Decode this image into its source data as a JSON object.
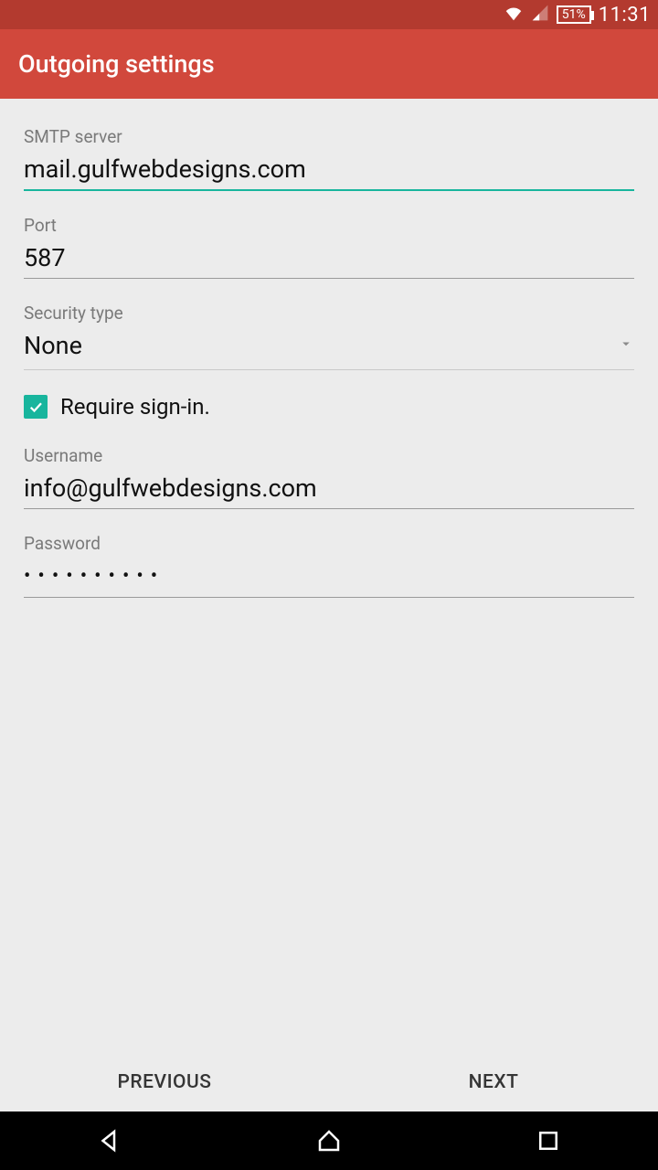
{
  "status_bar": {
    "battery_text": "51%",
    "time": "11:31"
  },
  "app_bar": {
    "title": "Outgoing settings"
  },
  "form": {
    "smtp_label": "SMTP server",
    "smtp_value": "mail.gulfwebdesigns.com",
    "port_label": "Port",
    "port_value": "587",
    "security_label": "Security type",
    "security_value": "None",
    "require_signin_label": "Require sign-in.",
    "require_signin_checked": true,
    "username_label": "Username",
    "username_value": "info@gulfwebdesigns.com",
    "password_label": "Password",
    "password_masked": "••••••••••"
  },
  "buttons": {
    "previous": "PREVIOUS",
    "next": "NEXT"
  },
  "colors": {
    "status_bar_bg": "#b33a2f",
    "app_bar_bg": "#d1483c",
    "accent": "#18b59d",
    "body_bg": "#ececec"
  }
}
